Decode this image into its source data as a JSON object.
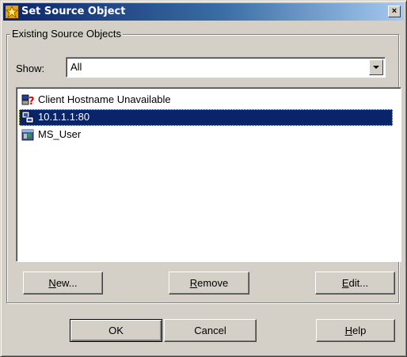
{
  "window": {
    "title": "Set Source Object",
    "close_label": "×"
  },
  "group": {
    "legend": "Existing Source Objects"
  },
  "filter": {
    "label": "Show:",
    "value": "All"
  },
  "list": {
    "items": [
      {
        "label": "Client Hostname Unavailable",
        "icon": "unknown-host-icon",
        "selected": false
      },
      {
        "label": "10.1.1.1:80",
        "icon": "network-address-icon",
        "selected": true
      },
      {
        "label": "MS_User",
        "icon": "user-directory-icon",
        "selected": false
      }
    ]
  },
  "buttons": {
    "new_mn": "N",
    "new_rest": "ew...",
    "remove_mn": "R",
    "remove_rest": "emove",
    "edit_mn": "E",
    "edit_rest": "dit...",
    "ok": "OK",
    "cancel": "Cancel",
    "help_mn": "H",
    "help_rest": "elp"
  },
  "colors": {
    "title_start": "#0a246a",
    "title_end": "#a6caf0",
    "selection": "#0a246a",
    "face": "#d4d0c8"
  }
}
